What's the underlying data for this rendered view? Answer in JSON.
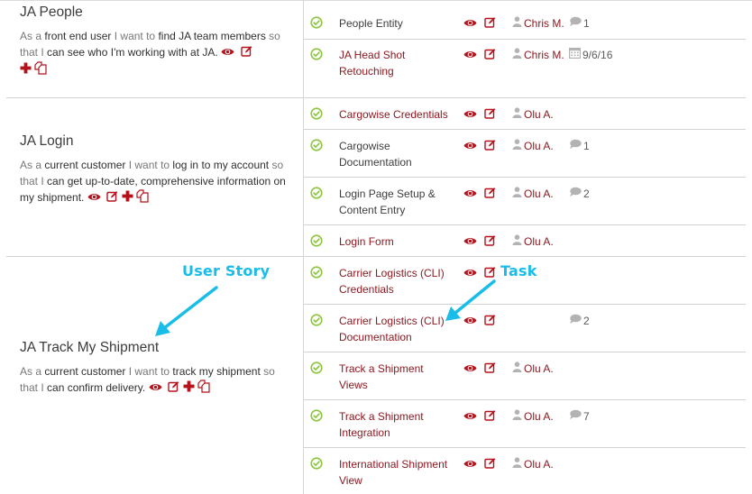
{
  "colors": {
    "accent_red": "#8b1a22",
    "icon_red": "#b5121b",
    "check_green": "#8cc63f",
    "muted_icon": "#b3b3b3",
    "annotation_blue": "#19bde8",
    "divider": "#d2d2d2"
  },
  "icons": {
    "view": "eye-icon",
    "edit": "edit-icon",
    "add": "plus-icon",
    "copy": "copy-icon",
    "status": "check-circle-icon",
    "assignee": "user-icon",
    "comments": "comment-icon",
    "due": "calendar-icon"
  },
  "stories": [
    {
      "title": "JA People",
      "text": {
        "p1": "As a ",
        "role": "front end user",
        "p2": " I want to ",
        "goal": "find JA team members",
        "p3": " so that I ",
        "benefit": "can see who I'm working with at JA."
      }
    },
    {
      "title": "JA Login",
      "text": {
        "p1": "As a ",
        "role": "current customer",
        "p2": " I want to ",
        "goal": "log in to my account",
        "p3": " so that I ",
        "benefit": "can get up-to-date, comprehensive information on my shipment."
      }
    },
    {
      "title": "JA Track My Shipment",
      "text": {
        "p1": "As a ",
        "role": "current customer",
        "p2": " I want to ",
        "goal": "track my shipment",
        "p3": " so that I ",
        "benefit": "can confirm delivery."
      }
    }
  ],
  "tasks": [
    {
      "title": "People Entity",
      "visited": true,
      "assignee": "Chris M.",
      "comments": "1",
      "due": null
    },
    {
      "title": "JA Head Shot Retouching",
      "visited": false,
      "assignee": "Chris M.",
      "comments": null,
      "due": "9/6/16"
    },
    {
      "title": "Cargowise Credentials",
      "visited": false,
      "assignee": "Olu A.",
      "comments": null,
      "due": null
    },
    {
      "title": "Cargowise Documentation",
      "visited": true,
      "assignee": "Olu A.",
      "comments": "1",
      "due": null
    },
    {
      "title": "Login Page Setup & Content Entry",
      "visited": true,
      "assignee": "Olu A.",
      "comments": "2",
      "due": null
    },
    {
      "title": "Login Form",
      "visited": false,
      "assignee": "Olu A.",
      "comments": null,
      "due": null
    },
    {
      "title": "Carrier Logistics (CLI) Credentials",
      "visited": false,
      "assignee": null,
      "comments": null,
      "due": null
    },
    {
      "title": "Carrier Logistics (CLI) Documentation",
      "visited": false,
      "assignee": null,
      "comments": "2",
      "due": null
    },
    {
      "title": "Track a Shipment Views",
      "visited": false,
      "assignee": "Olu A.",
      "comments": null,
      "due": null
    },
    {
      "title": "Track a Shipment Integration",
      "visited": false,
      "assignee": "Olu A.",
      "comments": "7",
      "due": null
    },
    {
      "title": "International Shipment View",
      "visited": false,
      "assignee": "Olu A.",
      "comments": null,
      "due": null
    }
  ],
  "annotations": {
    "user_story": "User Story",
    "task": "Task"
  }
}
